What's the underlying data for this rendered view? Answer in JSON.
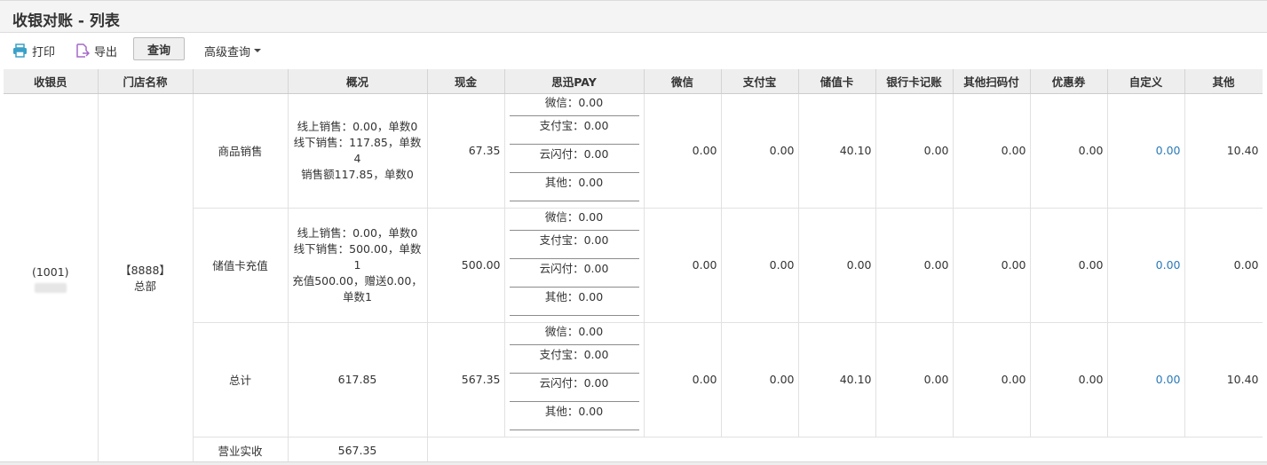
{
  "page": {
    "title": "收银对账 - 列表"
  },
  "toolbar": {
    "print_label": "打印",
    "export_label": "导出",
    "query_label": "查询",
    "advanced_label": "高级查询"
  },
  "table": {
    "headers": [
      "收银员",
      "门店名称",
      "",
      "概况",
      "现金",
      "思迅PAY",
      "微信",
      "支付宝",
      "储值卡",
      "银行卡记账",
      "其他扫码付",
      "优惠券",
      "自定义",
      "其他"
    ],
    "cashier": "(1001)",
    "store": {
      "code": "【8888】",
      "name": "总部"
    },
    "rows": [
      {
        "label": "商品销售",
        "summary": [
          "线上销售：0.00，单数0",
          "线下销售：117.85，单数4",
          "销售额117.85，单数0"
        ],
        "cash": "67.35",
        "pay": [
          "微信：0.00",
          "支付宝：0.00",
          "云闪付：0.00",
          "其他：0.00"
        ],
        "wechat": "0.00",
        "alipay": "0.00",
        "stored_card": "40.10",
        "bank_card": "0.00",
        "other_scan": "0.00",
        "coupon": "0.00",
        "custom": "0.00",
        "other": "10.40"
      },
      {
        "label": "储值卡充值",
        "summary": [
          "线上销售：0.00，单数0",
          "线下销售：500.00，单数1",
          "充值500.00，赠送0.00，单数1"
        ],
        "cash": "500.00",
        "pay": [
          "微信：0.00",
          "支付宝：0.00",
          "云闪付：0.00",
          "其他：0.00"
        ],
        "wechat": "0.00",
        "alipay": "0.00",
        "stored_card": "0.00",
        "bank_card": "0.00",
        "other_scan": "0.00",
        "coupon": "0.00",
        "custom": "0.00",
        "other": "0.00"
      },
      {
        "label": "总计",
        "summary": [
          "617.85"
        ],
        "cash": "567.35",
        "pay": [
          "微信：0.00",
          "支付宝：0.00",
          "云闪付：0.00",
          "其他：0.00"
        ],
        "wechat": "0.00",
        "alipay": "0.00",
        "stored_card": "40.10",
        "bank_card": "0.00",
        "other_scan": "0.00",
        "coupon": "0.00",
        "custom": "0.00",
        "other": "10.40"
      }
    ],
    "income": {
      "label": "营业实收",
      "value": "567.35"
    }
  },
  "colors": {
    "link": "#2a7ab8",
    "print_icon": "#3aa0c8",
    "export_icon": "#a36ac7"
  },
  "icons": {
    "print": "printer-icon",
    "export": "export-icon",
    "advanced": "caret-down-icon"
  }
}
